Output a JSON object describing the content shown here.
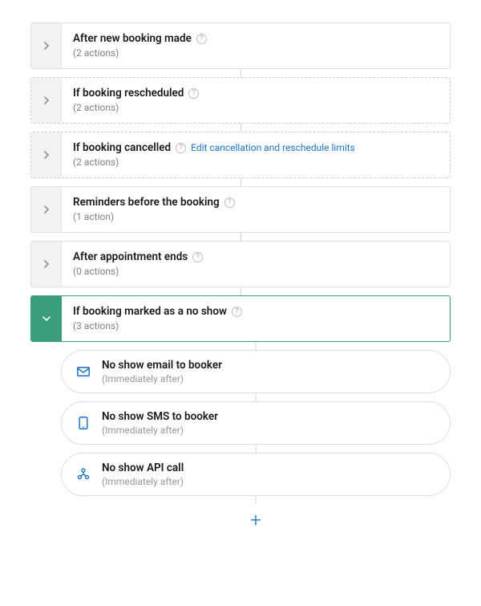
{
  "sections": [
    {
      "title": "After new booking made",
      "sub": "(2 actions)"
    },
    {
      "title": "If booking rescheduled",
      "sub": "(2 actions)"
    },
    {
      "title": "If booking cancelled",
      "sub": "(2 actions)",
      "link": "Edit cancellation and reschedule limits"
    },
    {
      "title": "Reminders before the booking",
      "sub": "(1 action)"
    },
    {
      "title": "After appointment ends",
      "sub": "(0 actions)"
    },
    {
      "title": "If booking marked as a no show",
      "sub": "(3 actions)"
    }
  ],
  "actions": [
    {
      "title": "No show email to booker",
      "sub": "(Immediately after)"
    },
    {
      "title": "No show SMS to booker",
      "sub": "(Immediately after)"
    },
    {
      "title": "No show API call",
      "sub": "(Immediately after)"
    }
  ],
  "add_label": "+"
}
